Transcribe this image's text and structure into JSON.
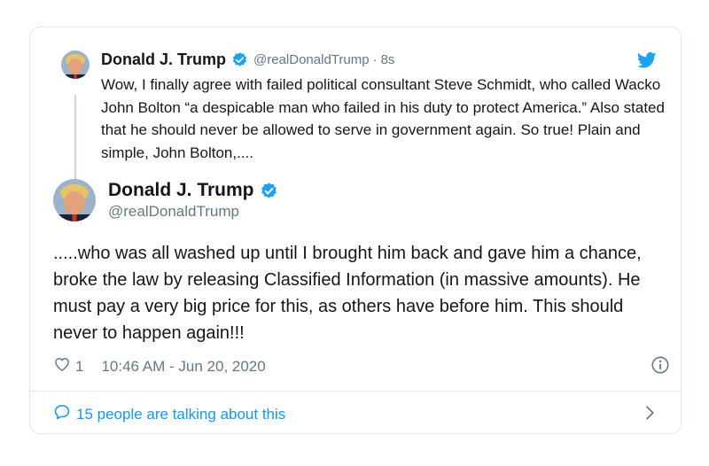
{
  "colors": {
    "accent": "#1da1f2",
    "verified": "#1da1f2",
    "secondary_text": "#657786",
    "link": "#1b95e0",
    "border": "#e1e8ed"
  },
  "parent_tweet": {
    "author_name": "Donald J. Trump",
    "author_handle": "@realDonaldTrump",
    "separator": "·",
    "time_ago": "8s",
    "text": "Wow, I finally agree with failed political consultant Steve Schmidt, who called Wacko John Bolton “a despicable man who failed in his duty to protect America.” Also stated that he should never be allowed to serve in government again. So true! Plain and simple, John Bolton,....",
    "avatar_icon": "profile-photo",
    "verified_icon": "verified-badge-icon"
  },
  "main_tweet": {
    "author_name": "Donald J. Trump",
    "author_handle": "@realDonaldTrump",
    "text": ".....who was all washed up until I brought him back and gave him a chance, broke the law by releasing Classified Information (in massive amounts). He must pay a very big price for this, as others have before him. This should never to happen again!!!",
    "like_count": "1",
    "timestamp": "10:46 AM - Jun 20, 2020",
    "avatar_icon": "profile-photo",
    "verified_icon": "verified-badge-icon"
  },
  "footer": {
    "talking_label": "15 people are talking about this",
    "talking_icon": "speech-bubble-icon",
    "chevron_icon": "chevron-right-icon"
  },
  "brand_icon": "twitter-bird-icon",
  "info_icon": "info-icon",
  "like_icon": "heart-icon"
}
